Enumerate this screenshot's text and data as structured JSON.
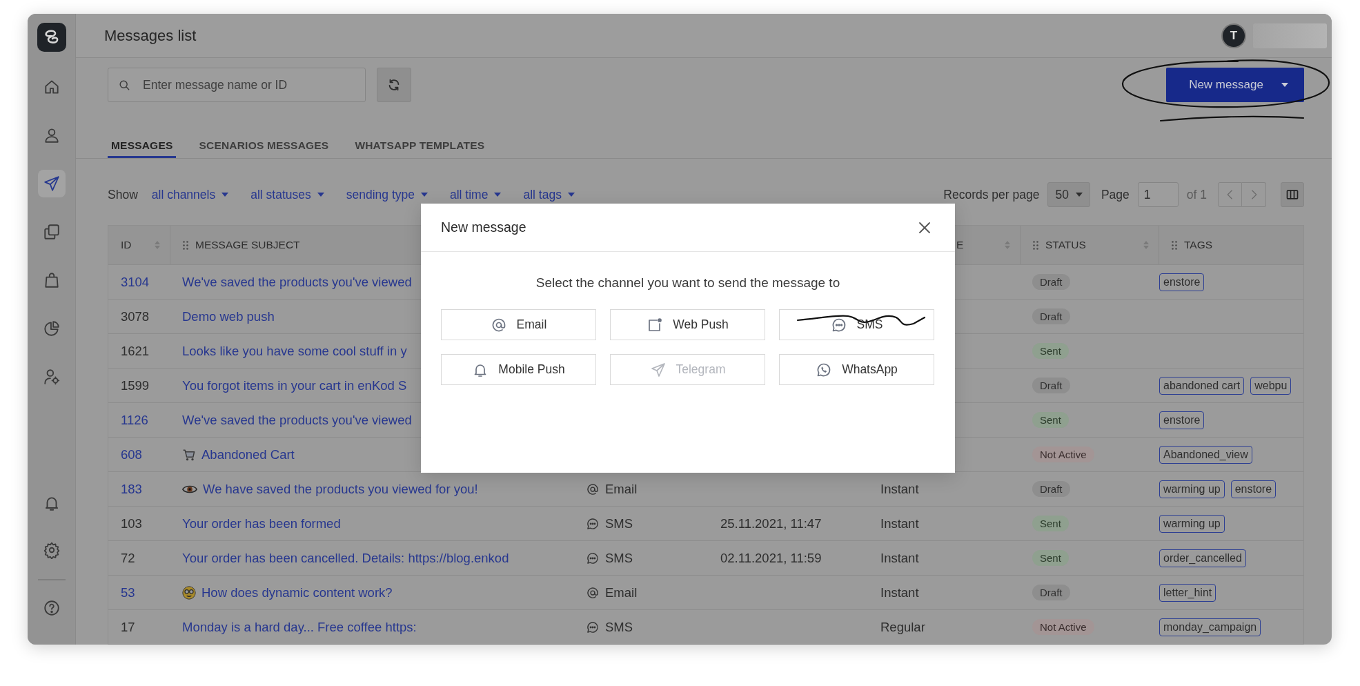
{
  "header": {
    "title": "Messages list",
    "avatar_initial": "T"
  },
  "sidebar": {
    "items": [
      {
        "kind": "home",
        "selected": false
      },
      {
        "kind": "user",
        "selected": false
      },
      {
        "kind": "send",
        "selected": true
      },
      {
        "kind": "copy",
        "selected": false
      },
      {
        "kind": "bag",
        "selected": false
      },
      {
        "kind": "pie",
        "selected": false
      },
      {
        "kind": "user-gear",
        "selected": false
      }
    ],
    "bottom_items": [
      {
        "kind": "bell",
        "selected": false
      },
      {
        "kind": "gear",
        "selected": false
      },
      {
        "kind": "help",
        "selected": false
      }
    ]
  },
  "toolbar": {
    "search": {
      "placeholder": "Enter message name or ID"
    },
    "new_button": "New message"
  },
  "tabs": [
    {
      "label": "MESSAGES",
      "selected": true
    },
    {
      "label": "SCENARIOS MESSAGES",
      "selected": false
    },
    {
      "label": "WHATSAPP TEMPLATES",
      "selected": false
    }
  ],
  "filters": {
    "label": "Show",
    "dropdowns": [
      "all channels",
      "all statuses",
      "sending type",
      "all time",
      "all tags"
    ]
  },
  "pagination": {
    "records_label": "Records per page",
    "per_page": "50",
    "page_label": "Page",
    "page": "1",
    "of": "of 1"
  },
  "table": {
    "columns": [
      {
        "label": "ID",
        "sortable": true,
        "handle": false
      },
      {
        "label": "MESSAGE SUBJECT",
        "sortable": false,
        "handle": true
      },
      {
        "label": "E",
        "sortable": true,
        "handle": false
      },
      {
        "label": "STATUS",
        "sortable": true,
        "handle": true
      },
      {
        "label": "TAGS",
        "sortable": false,
        "handle": true
      }
    ],
    "rows": [
      {
        "id": "3104",
        "id_link": true,
        "kind": "plain",
        "subject": "We've saved the products you've viewed",
        "status": {
          "label": "Draft",
          "kind": "draft"
        },
        "tags": [
          "enstore"
        ]
      },
      {
        "id": "3078",
        "id_link": false,
        "kind": "plain",
        "subject": "Demo web push",
        "status": {
          "label": "Draft",
          "kind": "draft"
        },
        "tags": []
      },
      {
        "id": "1621",
        "id_link": false,
        "kind": "plain",
        "subject": "Looks like you have some cool stuff in y",
        "status": {
          "label": "Sent",
          "kind": "sent"
        },
        "tags": []
      },
      {
        "id": "1599",
        "id_link": false,
        "kind": "plain",
        "subject": "You forgot items in your cart in enKod S",
        "status": {
          "label": "Draft",
          "kind": "draft"
        },
        "tags": [
          "abandoned cart",
          "webpu"
        ]
      },
      {
        "id": "1126",
        "id_link": true,
        "kind": "plain",
        "subject": "We've saved the products you've viewed",
        "status": {
          "label": "Sent",
          "kind": "sent"
        },
        "tags": [
          "enstore"
        ]
      },
      {
        "id": "608",
        "id_link": true,
        "kind": "cart",
        "subject": "Abandoned Cart",
        "status": {
          "label": "Not Active",
          "kind": "inactive"
        },
        "tags": [
          "Abandoned_view"
        ]
      },
      {
        "id": "183",
        "id_link": true,
        "kind": "eye",
        "subject": "We have saved the products you viewed for you!",
        "channel": {
          "kind": "email",
          "label": "Email"
        },
        "type": "Instant",
        "status": {
          "label": "Draft",
          "kind": "draft"
        },
        "tags": [
          "warming up",
          "enstore"
        ]
      },
      {
        "id": "103",
        "id_link": false,
        "kind": "plain",
        "subject": "Your order has been formed",
        "channel": {
          "kind": "sms",
          "label": "SMS"
        },
        "date": "25.11.2021, 11:47",
        "type": "Instant",
        "status": {
          "label": "Sent",
          "kind": "sent"
        },
        "tags": [
          "warming up"
        ]
      },
      {
        "id": "72",
        "id_link": false,
        "kind": "plain",
        "subject": "Your order has been cancelled. Details: https://blog.enkod",
        "channel": {
          "kind": "sms",
          "label": "SMS"
        },
        "date": "02.11.2021, 11:59",
        "type": "Instant",
        "status": {
          "label": "Sent",
          "kind": "sent"
        },
        "tags": [
          "order_cancelled"
        ]
      },
      {
        "id": "53",
        "id_link": true,
        "kind": "face",
        "subject": "How does dynamic content work?",
        "channel": {
          "kind": "email",
          "label": "Email"
        },
        "type": "Instant",
        "status": {
          "label": "Draft",
          "kind": "draft"
        },
        "tags": [
          "letter_hint"
        ]
      },
      {
        "id": "17",
        "id_link": false,
        "kind": "plain",
        "subject": "Monday is a hard day... Free coffee https:",
        "channel": {
          "kind": "sms",
          "label": "SMS"
        },
        "type": "Regular",
        "status": {
          "label": "Not Active",
          "kind": "inactive"
        },
        "tags": [
          "monday_campaign"
        ]
      }
    ]
  },
  "modal": {
    "title": "New message",
    "prompt": "Select the channel you want to send the message to",
    "channels": [
      {
        "label": "Email",
        "kind": "email",
        "disabled": false
      },
      {
        "label": "Web Push",
        "kind": "webpush",
        "disabled": false
      },
      {
        "label": "SMS",
        "kind": "sms",
        "disabled": false
      },
      {
        "label": "Mobile Push",
        "kind": "bell",
        "disabled": false
      },
      {
        "label": "Telegram",
        "kind": "send",
        "disabled": true
      },
      {
        "label": "WhatsApp",
        "kind": "whatsapp",
        "disabled": false
      }
    ]
  }
}
